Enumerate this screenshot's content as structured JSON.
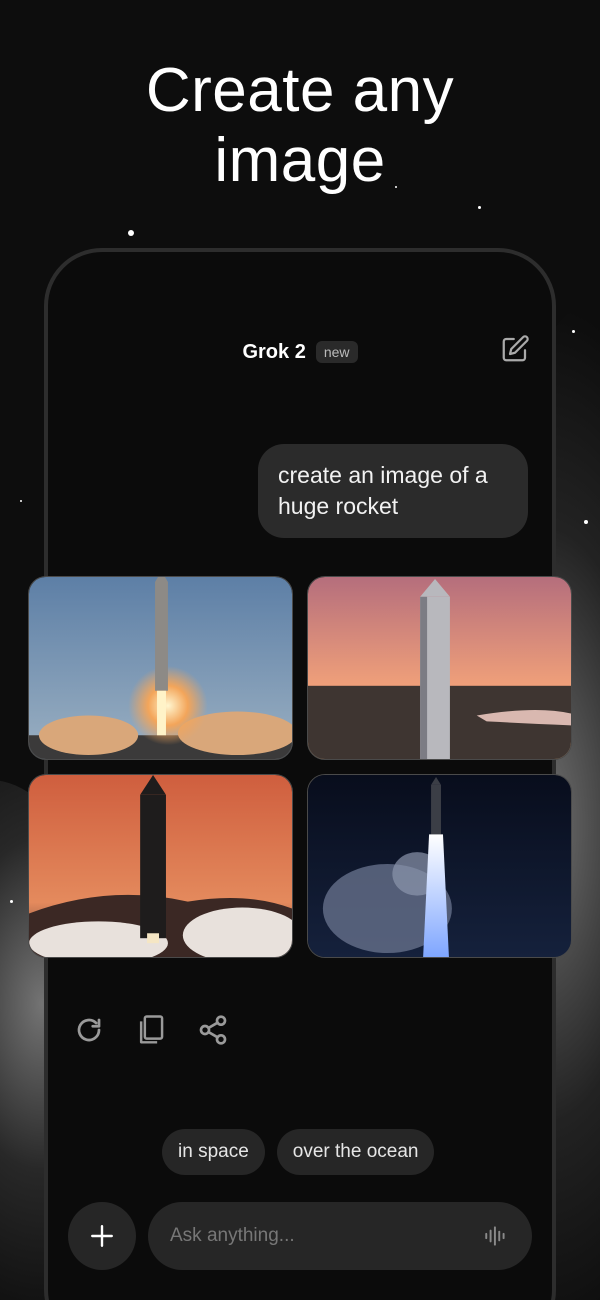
{
  "headline": {
    "line1": "Create any",
    "line2": "image"
  },
  "header": {
    "model": "Grok 2",
    "badge": "new"
  },
  "message": {
    "text": "create an image of a huge rocket"
  },
  "images": [
    {
      "icon": "rocket-launch-day-image"
    },
    {
      "icon": "rocket-sunset-image"
    },
    {
      "icon": "rocket-launch-dusk-image"
    },
    {
      "icon": "rocket-launch-night-image"
    }
  ],
  "actions": [
    {
      "icon": "refresh-icon"
    },
    {
      "icon": "copy-icon"
    },
    {
      "icon": "share-icon"
    }
  ],
  "suggestions": [
    "in space",
    "over the ocean"
  ],
  "composer": {
    "placeholder": "Ask anything..."
  },
  "colors": {
    "background": "#0d0d0d",
    "surface": "#262626",
    "bubble": "#2b2b2b",
    "text": "#ffffff"
  }
}
